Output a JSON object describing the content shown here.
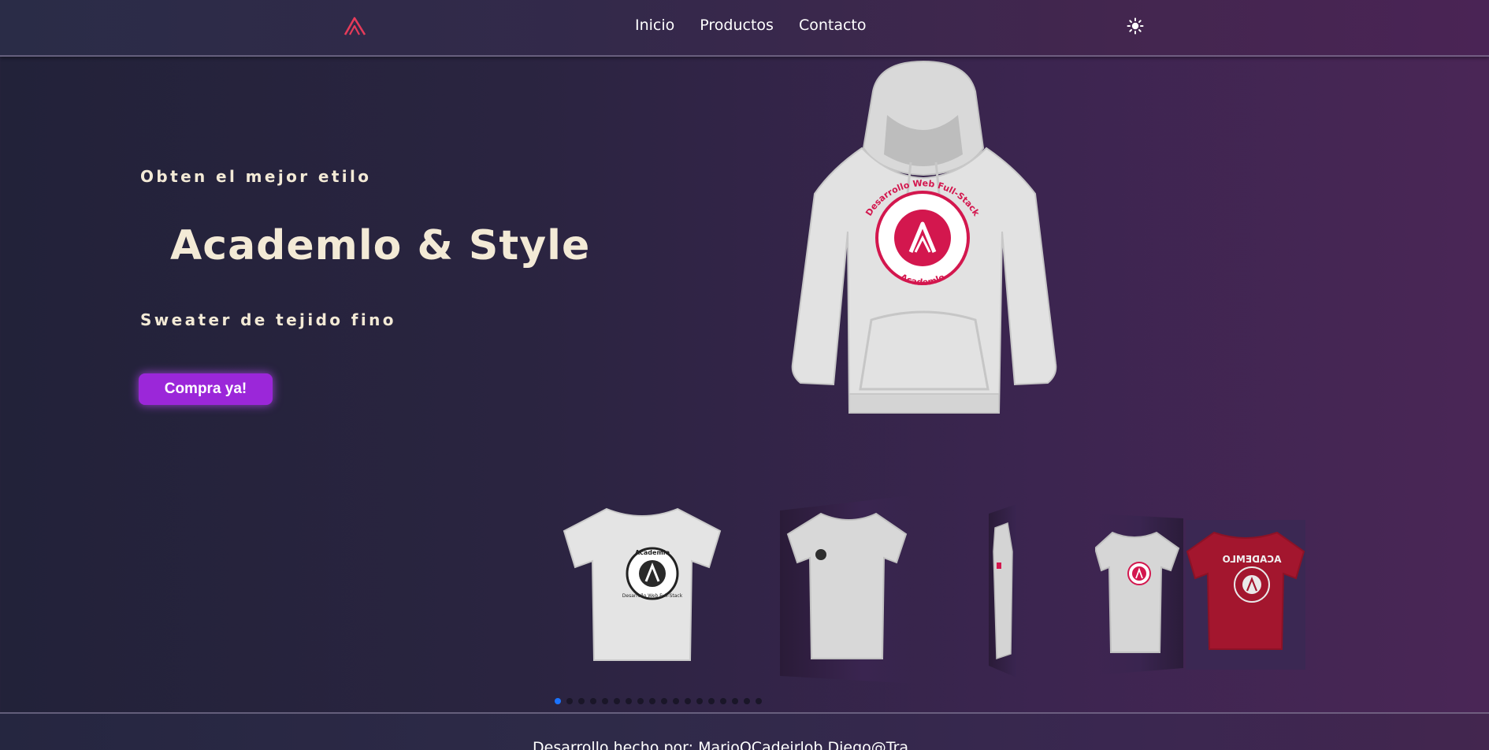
{
  "brand": {
    "logo": "academlo-logo",
    "accent": "#e63b5a"
  },
  "nav": {
    "items": [
      {
        "label": "Inicio"
      },
      {
        "label": "Productos"
      },
      {
        "label": "Contacto"
      }
    ]
  },
  "theme_toggle": {
    "icon": "sun-icon"
  },
  "hero": {
    "eyebrow": "Obten el mejor etilo",
    "title": "Academlo & Style",
    "subtitle": "Sweater de tejido fino",
    "cta_label": "Compra ya!",
    "cta_color": "#9b27d9",
    "image": "hoodie-image",
    "image_print": {
      "ring_text": "Desarrollo Web Full-Stack",
      "bottom_text": "Academlo"
    }
  },
  "carousel": {
    "slides": [
      {
        "image": "white-tshirt-dark-logo",
        "print_top": "Academlo",
        "print_ring": "Desarrollo Web Full-Stack"
      },
      {
        "image": "gray-tshirt-small-logo"
      },
      {
        "image": "gray-tshirt-side"
      },
      {
        "image": "gray-tshirt-red-logo"
      },
      {
        "image": "red-tshirt-back",
        "print_top": "ACADEMLO"
      }
    ],
    "dot_count": 18,
    "active_dot": 0,
    "active_color": "#1a73ff"
  },
  "footer": {
    "text": "Desarrollo hecho por: MarioOCadeirlob  Diego@Tra..."
  }
}
